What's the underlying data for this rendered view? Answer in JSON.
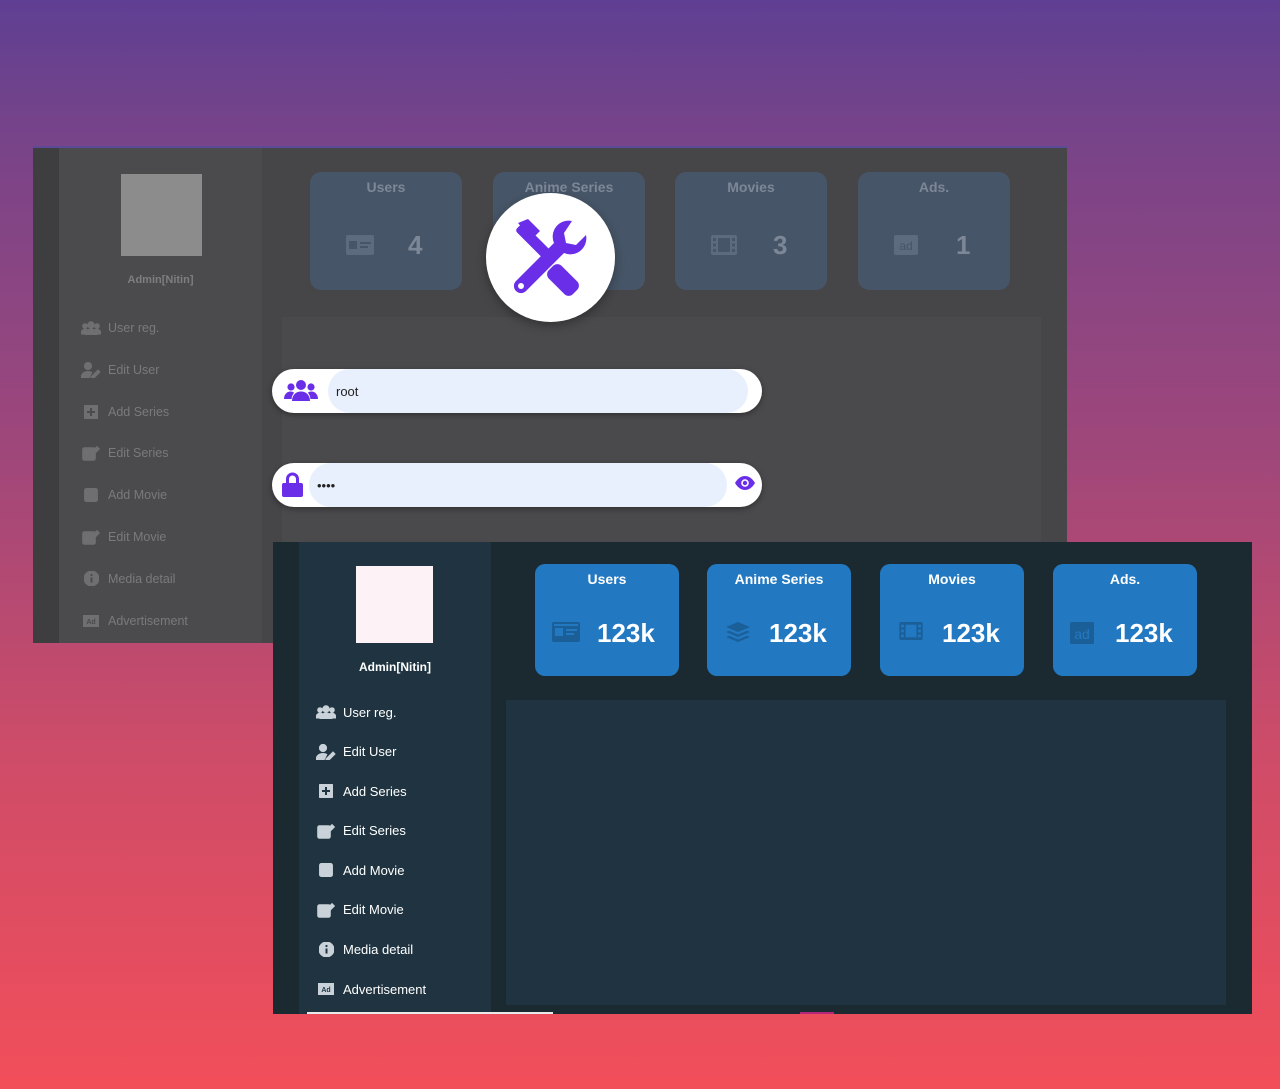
{
  "back": {
    "admin_label": "Admin[Nitin]",
    "nav": [
      {
        "label": "User reg.",
        "icon": "users-icon"
      },
      {
        "label": "Edit User",
        "icon": "user-edit-icon"
      },
      {
        "label": "Add Series",
        "icon": "plus-square-icon"
      },
      {
        "label": "Edit Series",
        "icon": "edit-icon"
      },
      {
        "label": "Add Movie",
        "icon": "plus-square-outline-icon"
      },
      {
        "label": "Edit Movie",
        "icon": "edit-icon"
      },
      {
        "label": "Media detail",
        "icon": "info-circle-icon"
      },
      {
        "label": "Advertisement",
        "icon": "ad-icon"
      }
    ],
    "cards": [
      {
        "title": "Users",
        "value": "4",
        "icon": "id-card-icon"
      },
      {
        "title": "Anime Series",
        "value": "",
        "icon": "layers-icon"
      },
      {
        "title": "Movies",
        "value": "3",
        "icon": "film-icon"
      },
      {
        "title": "Ads.",
        "value": "1",
        "icon": "ad-icon"
      }
    ],
    "login": {
      "username_value": "root",
      "password_value": "••••",
      "username_icon": "users-icon",
      "password_icon": "lock-icon",
      "toggle_icon": "eye-icon"
    },
    "badge_icon": "tools-icon"
  },
  "front": {
    "admin_label": "Admin[Nitin]",
    "nav": [
      {
        "label": "User reg.",
        "icon": "users-icon"
      },
      {
        "label": "Edit User",
        "icon": "user-edit-icon"
      },
      {
        "label": "Add Series",
        "icon": "plus-square-icon"
      },
      {
        "label": "Edit Series",
        "icon": "edit-icon"
      },
      {
        "label": "Add Movie",
        "icon": "plus-square-outline-icon"
      },
      {
        "label": "Edit Movie",
        "icon": "edit-icon"
      },
      {
        "label": "Media detail",
        "icon": "info-circle-icon"
      },
      {
        "label": "Advertisement",
        "icon": "ad-icon"
      }
    ],
    "cards": [
      {
        "title": "Users",
        "value": "123k",
        "icon": "id-card-icon"
      },
      {
        "title": "Anime Series",
        "value": "123k",
        "icon": "layers-icon"
      },
      {
        "title": "Movies",
        "value": "123k",
        "icon": "film-icon"
      },
      {
        "title": "Ads.",
        "value": "123k",
        "icon": "ad-icon"
      }
    ]
  },
  "colors": {
    "accent_purple": "#6a2ee8",
    "card_blue": "#2279c2",
    "front_bg": "#1b2a30",
    "sidebar_bg": "#1f3440"
  }
}
